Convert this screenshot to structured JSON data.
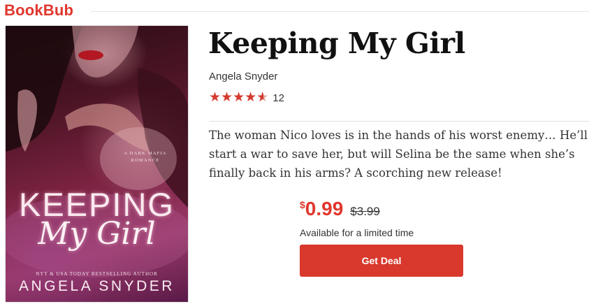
{
  "brand": {
    "logo_text": "BookBub",
    "color": "#e0372e"
  },
  "book": {
    "title": "Keeping My Girl",
    "author": "Angela Snyder",
    "rating": {
      "stars": 4.6,
      "max": 5,
      "count": "12"
    },
    "description": "The woman Nico loves is in the hands of his worst enemy… He’ll start a war to save her, but will Selina be the same when she’s finally back in his arms? A scorching new release!"
  },
  "cover": {
    "tagline": "A DARK MAFIA ROMANCE",
    "title_line1": "KEEPING",
    "title_line2": "My Girl",
    "kicker": "NYT & USA TODAY BESTSELLING AUTHOR",
    "author": "ANGELA SNYDER"
  },
  "deal": {
    "currency": "$",
    "price": "0.99",
    "original_price": "$3.99",
    "availability": "Available for a limited time",
    "button_label": "Get Deal",
    "button_color": "#d9382d"
  }
}
